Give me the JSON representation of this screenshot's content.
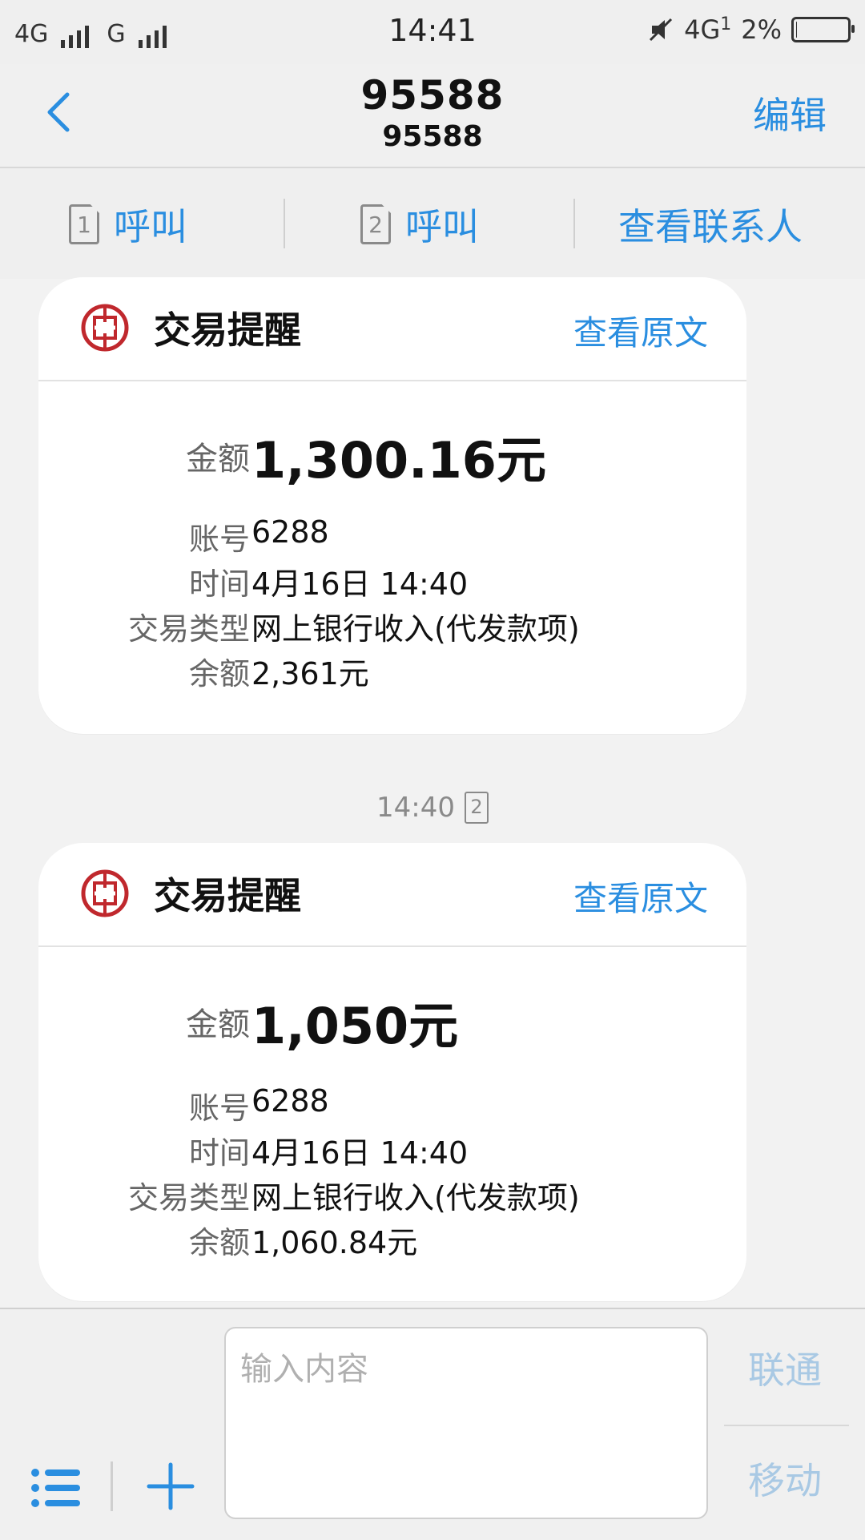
{
  "status_bar": {
    "left": [
      "4G",
      "G"
    ],
    "time": "14:41",
    "network": "4G",
    "network_sub": "1",
    "battery": "2%",
    "battery_level": 0.02
  },
  "header": {
    "title": "95588",
    "subtitle": "95588",
    "edit_label": "编辑"
  },
  "actions": {
    "call1": {
      "sim": "1",
      "label": "呼叫"
    },
    "call2": {
      "sim": "2",
      "label": "呼叫"
    },
    "contact": "查看联系人"
  },
  "cards": [
    {
      "title": "交易提醒",
      "view_label": "查看原文",
      "amount_label": "金额",
      "amount": "1,300.16元",
      "account_label": "账号",
      "account": "6288",
      "time_label": "时间",
      "time": "4月16日 14:40",
      "type_label": "交易类型",
      "type": "网上银行收入(代发款项)",
      "balance_label": "余额",
      "balance": "2,361元"
    },
    {
      "title": "交易提醒",
      "view_label": "查看原文",
      "amount_label": "金额",
      "amount": "1,050元",
      "account_label": "账号",
      "account": "6288",
      "time_label": "时间",
      "time": "4月16日 14:40",
      "type_label": "交易类型",
      "type": "网上银行收入(代发款项)",
      "balance_label": "余额",
      "balance": "1,060.84元"
    }
  ],
  "timestamp": {
    "time": "14:40",
    "sim": "2"
  },
  "composer": {
    "placeholder": "输入内容",
    "send_unicom": "联通",
    "send_mobile": "移动"
  },
  "colors": {
    "accent": "#2a8ee0",
    "bank_red": "#c0282d",
    "send_disabled": "#a9c9e4"
  }
}
